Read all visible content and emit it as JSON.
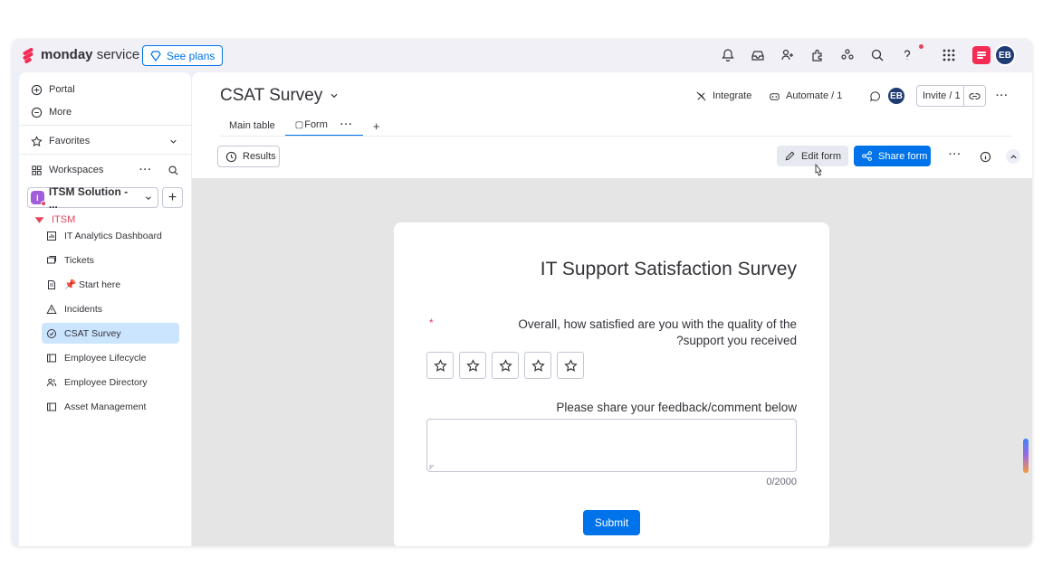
{
  "app": {
    "brand_bold": "monday",
    "brand_light": "service",
    "see_plans": "See plans",
    "user_initials": "EB"
  },
  "sidebar": {
    "portal": "Portal",
    "more": "More",
    "favorites": "Favorites",
    "workspaces": "Workspaces",
    "workspace_name": "ITSM Solution - ...",
    "workspace_badge": "I",
    "folder": "ITSM",
    "boards": [
      {
        "label": "IT Analytics Dashboard",
        "icon": "dashboard-icon"
      },
      {
        "label": "Tickets",
        "icon": "tickets-icon"
      },
      {
        "label": "📌 Start here",
        "icon": "doc-icon"
      },
      {
        "label": "Incidents",
        "icon": "warning-icon"
      },
      {
        "label": "CSAT Survey",
        "icon": "form-icon",
        "active": true
      },
      {
        "label": "Employee Lifecycle",
        "icon": "board-icon"
      },
      {
        "label": "Employee Directory",
        "icon": "people-icon"
      },
      {
        "label": "Asset Management",
        "icon": "board-icon"
      }
    ]
  },
  "board": {
    "title": "CSAT Survey",
    "tabs": [
      {
        "label": "Main table"
      },
      {
        "label": "Form",
        "active": true
      }
    ],
    "integrate": "Integrate",
    "automate": "Automate / 1",
    "invite": "Invite / 1",
    "results": "Results",
    "edit_form": "Edit form",
    "share_form": "Share form"
  },
  "form": {
    "title": "IT Support Satisfaction Survey",
    "question_line1": "Overall, how satisfied are you with the quality of the",
    "question_line2": "?support you received",
    "required_mark": "*",
    "feedback_label": "Please share your feedback/comment below",
    "counter": "0/2000",
    "submit": "Submit",
    "rating_max": 5,
    "rating_value": 0
  },
  "colors": {
    "accent": "#0073ea",
    "brand": "#f62b54",
    "active_item_bg": "#cce5ff",
    "folder": "#e2445c"
  }
}
